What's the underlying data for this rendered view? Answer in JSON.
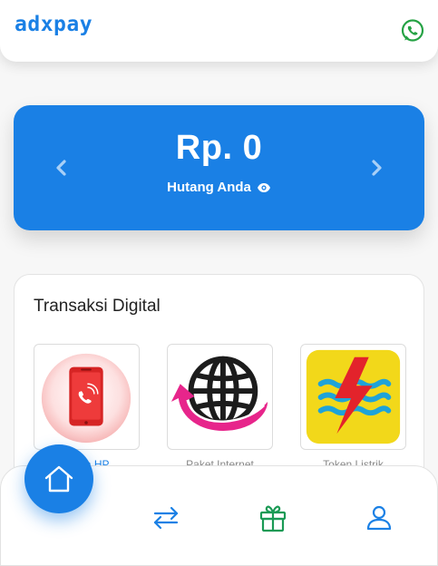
{
  "header": {
    "brand": "adxpay",
    "whatsapp_icon": "whatsapp-icon"
  },
  "debt": {
    "amount": "Rp. 0",
    "label": "Hutang Anda",
    "toggle_icon": "eye-icon",
    "prev_icon": "chevron-left-icon",
    "next_icon": "chevron-right-icon"
  },
  "digital": {
    "title": "Transaksi Digital",
    "items": [
      {
        "label": "Pulsa HP",
        "icon": "phone-call-icon"
      },
      {
        "label": "Paket Internet",
        "icon": "globe-arrow-icon"
      },
      {
        "label": "Token Listrik",
        "icon": "pln-lightning-icon"
      }
    ]
  },
  "nav": {
    "items": [
      {
        "name": "home",
        "icon": "home-icon",
        "active": true
      },
      {
        "name": "transfer",
        "icon": "transfer-arrows-icon"
      },
      {
        "name": "rewards",
        "icon": "gift-icon"
      },
      {
        "name": "profile",
        "icon": "user-icon"
      }
    ]
  },
  "colors": {
    "primary": "#1a80e5",
    "whatsapp": "#25a244",
    "gift": "#1a9a55",
    "pln_yellow": "#f2d81a",
    "pln_red": "#e3232b",
    "pln_blue": "#1fa3d8",
    "internet_pink": "#e7258b"
  }
}
